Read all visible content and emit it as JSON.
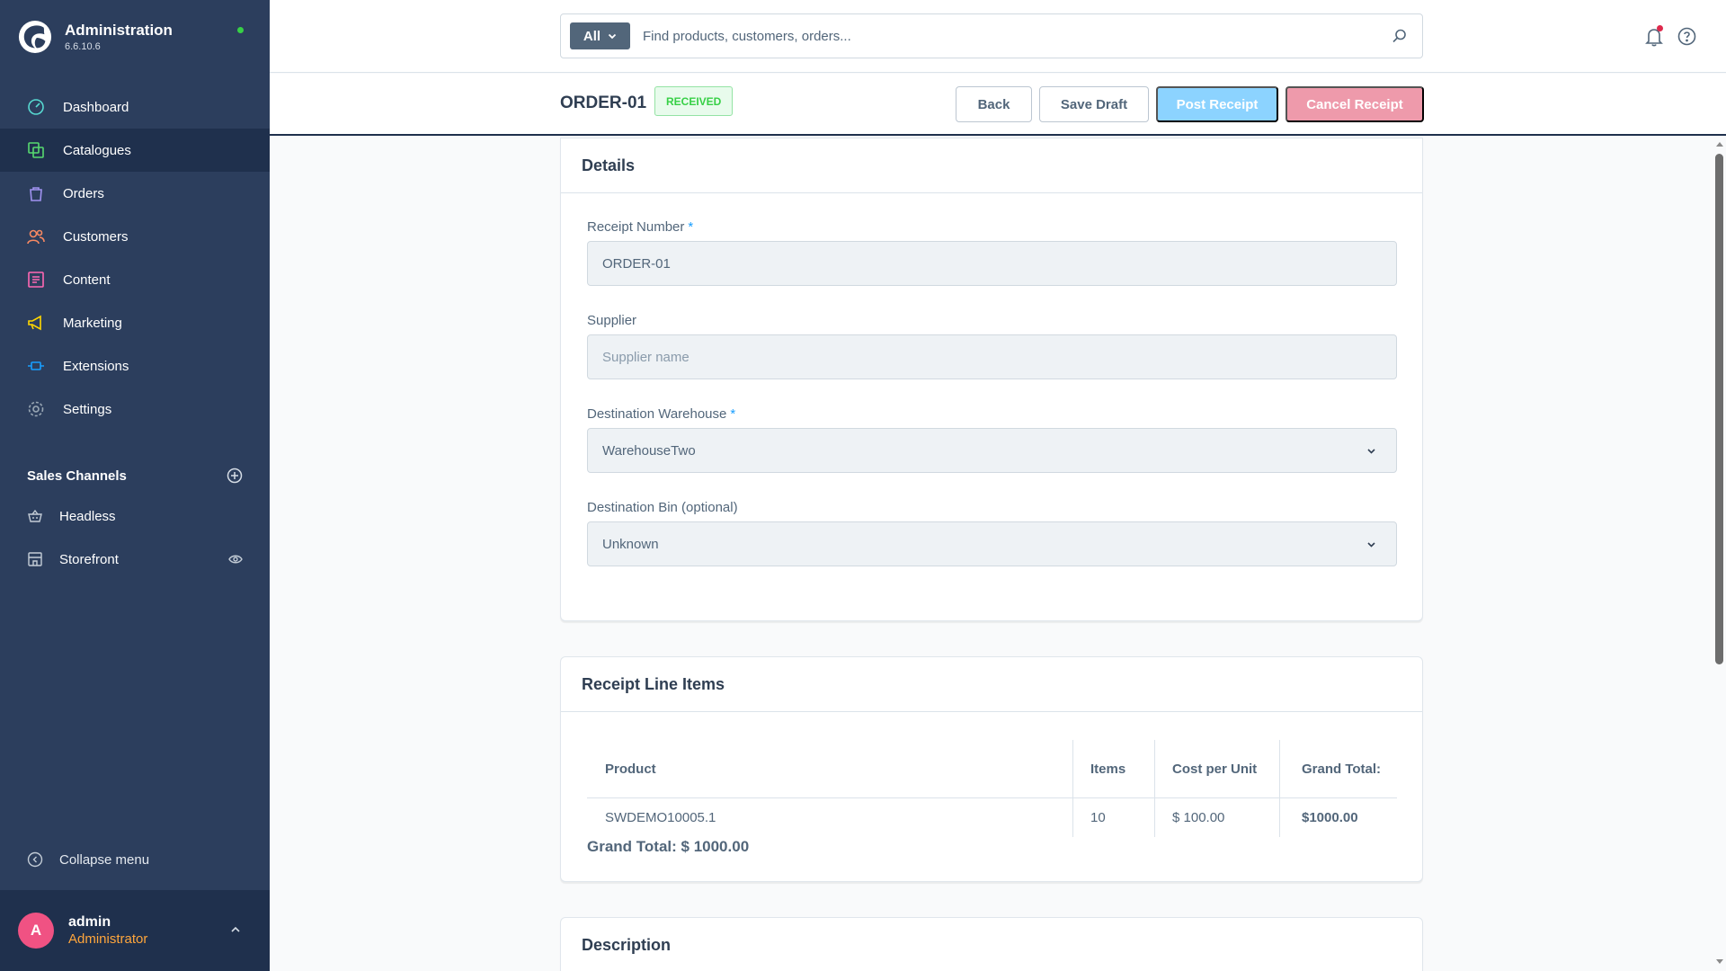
{
  "app": {
    "title": "Administration",
    "version": "6.6.10.6",
    "status_color": "#37d046"
  },
  "nav": {
    "items": [
      {
        "label": "Dashboard",
        "icon": "dashboard-gauge-icon"
      },
      {
        "label": "Catalogues",
        "icon": "catalogue-layers-icon",
        "active": true
      },
      {
        "label": "Orders",
        "icon": "shopping-bag-icon"
      },
      {
        "label": "Customers",
        "icon": "users-icon"
      },
      {
        "label": "Content",
        "icon": "content-list-icon"
      },
      {
        "label": "Marketing",
        "icon": "megaphone-icon"
      },
      {
        "label": "Extensions",
        "icon": "plug-icon"
      },
      {
        "label": "Settings",
        "icon": "gear-icon"
      }
    ]
  },
  "sales_channels": {
    "heading": "Sales Channels",
    "items": [
      {
        "label": "Headless",
        "icon": "basket-icon"
      },
      {
        "label": "Storefront",
        "icon": "storefront-icon"
      }
    ]
  },
  "collapse_label": "Collapse menu",
  "user": {
    "initial": "A",
    "name": "admin",
    "role": "Administrator"
  },
  "search": {
    "scope": "All",
    "placeholder": "Find products, customers, orders..."
  },
  "smartbar": {
    "title": "ORDER-01",
    "badge": "RECEIVED",
    "back_label": "Back",
    "save_draft_label": "Save Draft",
    "post_label": "Post Receipt",
    "cancel_label": "Cancel Receipt"
  },
  "details": {
    "heading": "Details",
    "receipt_number_label": "Receipt Number",
    "receipt_number_value": "ORDER-01",
    "supplier_label": "Supplier",
    "supplier_placeholder": "Supplier name",
    "warehouse_label": "Destination Warehouse",
    "warehouse_value": "WarehouseTwo",
    "bin_label": "Destination Bin (optional)",
    "bin_value": "Unknown",
    "required_mark": "*"
  },
  "lines": {
    "heading": "Receipt Line Items",
    "columns": [
      "Product",
      "Items",
      "Cost per Unit",
      "Grand Total:"
    ],
    "rows": [
      {
        "product": "SWDEMO10005.1",
        "items": "10",
        "cost": "$ 100.00",
        "total": "$1000.00"
      }
    ],
    "grand_total": "Grand Total: $ 1000.00"
  },
  "description": {
    "heading": "Description"
  }
}
